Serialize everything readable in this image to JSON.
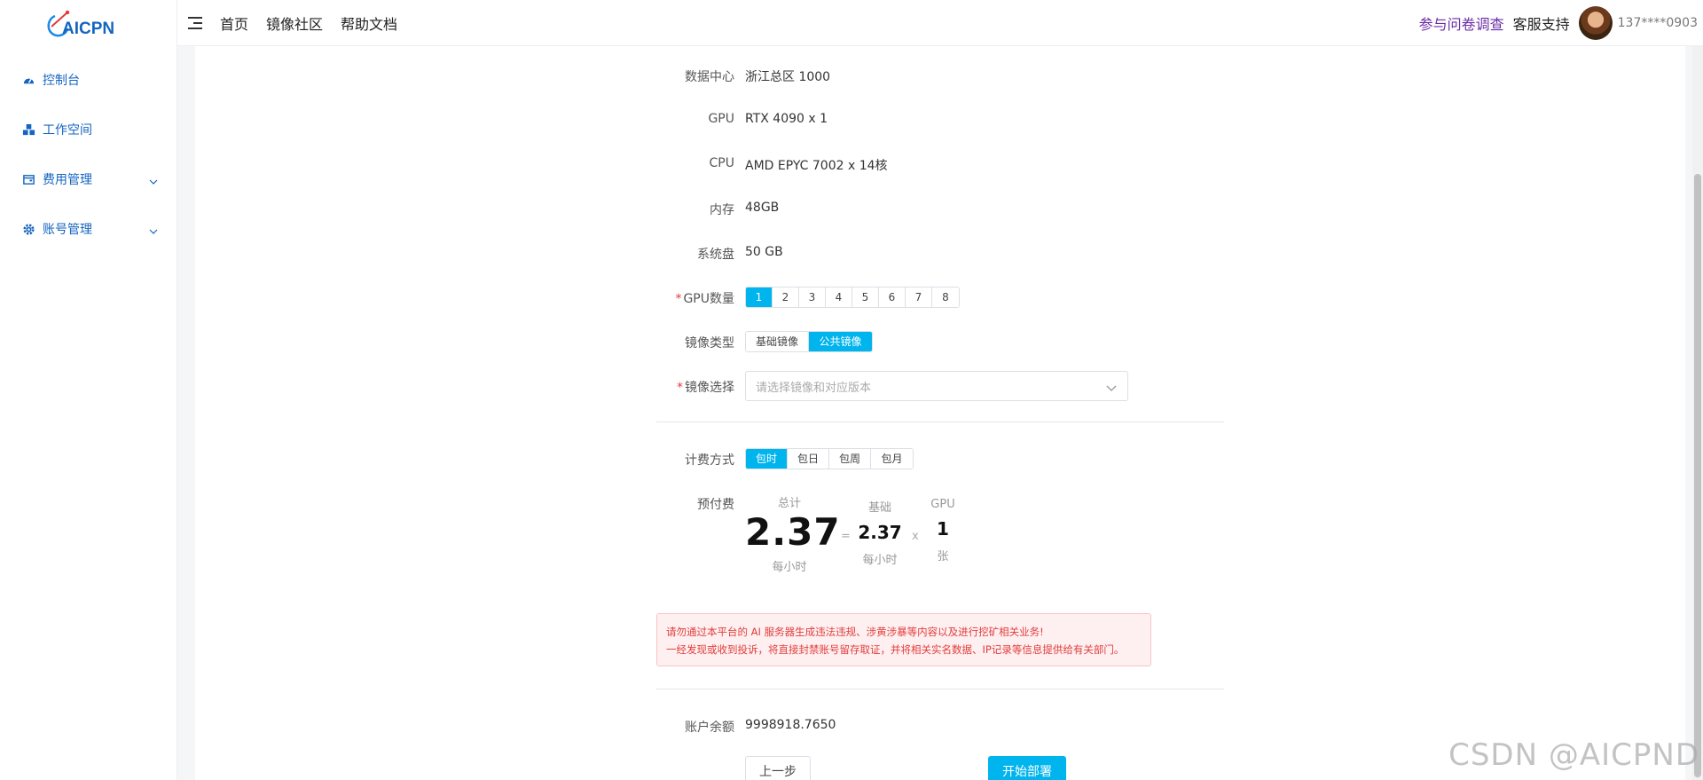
{
  "brand": {
    "logo_text": "AICPN"
  },
  "sidebar": {
    "items": [
      {
        "label": "控制台",
        "icon": "dashboard-icon"
      },
      {
        "label": "工作空间",
        "icon": "workspace-icon"
      },
      {
        "label": "费用管理",
        "icon": "billing-icon"
      },
      {
        "label": "账号管理",
        "icon": "gear-icon"
      }
    ]
  },
  "header": {
    "nav": [
      "首页",
      "镜像社区",
      "帮助文档"
    ],
    "survey": "参与问卷调查",
    "support": "客服支持",
    "username": "137****0903"
  },
  "form": {
    "datacenter_label": "数据中心",
    "datacenter_value": "浙江总区 1000",
    "gpu_label": "GPU",
    "gpu_value": "RTX 4090 x 1",
    "cpu_label": "CPU",
    "cpu_value": "AMD EPYC 7002 x 14核",
    "memory_label": "内存",
    "memory_value": "48GB",
    "disk_label": "系统盘",
    "disk_value": "50 GB",
    "gpu_count_label": "GPU数量",
    "gpu_count_options": [
      "1",
      "2",
      "3",
      "4",
      "5",
      "6",
      "7",
      "8"
    ],
    "gpu_count_selected": "1",
    "image_type_label": "镜像类型",
    "image_type_options": [
      "基础镜像",
      "公共镜像"
    ],
    "image_type_selected": "公共镜像",
    "image_select_label": "镜像选择",
    "image_select_placeholder": "请选择镜像和对应版本",
    "billing_label": "计费方式",
    "billing_options": [
      "包时",
      "包日",
      "包周",
      "包月"
    ],
    "billing_selected": "包时",
    "prepay_label": "预付费",
    "price": {
      "total_label": "总计",
      "total_value": "2.37",
      "total_unit": "每小时",
      "eq": "=",
      "base_label": "基础",
      "base_value": "2.37",
      "base_unit": "每小时",
      "times": "x",
      "gpu_label": "GPU",
      "gpu_value": "1",
      "gpu_unit": "张"
    },
    "warning_line1": "请勿通过本平台的 AI 服务器生成违法违规、涉黄涉暴等内容以及进行挖矿相关业务!",
    "warning_line2": "一经发现或收到投诉，将直接封禁账号留存取证，并将相关实名数据、IP记录等信息提供给有关部门。",
    "balance_label": "账户余额",
    "balance_value": "9998918.7650",
    "prev_button": "上一步",
    "deploy_button": "开始部署"
  },
  "watermark": "CSDN @AICPND",
  "colors": {
    "accent": "#00b4ee",
    "sidebar_text": "#1565c0",
    "danger": "#e23c3c"
  }
}
